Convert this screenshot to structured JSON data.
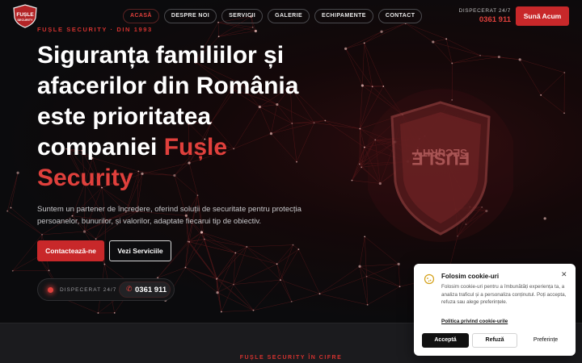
{
  "brand": {
    "logo_text_top": "FUȘLE",
    "logo_text_bottom": "SECURITY",
    "accent_color": "#c8282a",
    "accent_text_color": "#e0403c"
  },
  "nav": {
    "items": [
      {
        "label": "ACASĂ",
        "active": true
      },
      {
        "label": "DESPRE NOI",
        "active": false
      },
      {
        "label": "SERVICII",
        "active": false
      },
      {
        "label": "GALERIE",
        "active": false
      },
      {
        "label": "ECHIPAMENTE",
        "active": false
      },
      {
        "label": "CONTACT",
        "active": false
      }
    ]
  },
  "header": {
    "dispatch_label": "DISPECERAT 24/7",
    "dispatch_number": "0361 911",
    "call_button": "Sună Acum"
  },
  "hero": {
    "kicker": "FUȘLE SECURITY · DIN 1993",
    "headline_lines": [
      "Siguranța familiilor și",
      "afacerilor din România",
      "este prioritatea",
      "companiei "
    ],
    "headline_accent_inline": "Fușle",
    "headline_accent_line": "Security",
    "lead": "Suntem un partener de încredere, oferind soluții de securitate pentru protecția persoanelor, bunurilor, și valorilor, adaptate fiecarui tip de obiectiv.",
    "primary_button": "Contactează-ne",
    "secondary_button": "Vezi Serviciile",
    "dispatch_label": "DISPECERAT 24/7",
    "dispatch_number": "0361 911",
    "shield_text_top": "FUȘLE",
    "shield_text_bottom": "SECURITY"
  },
  "stats": {
    "kicker": "FUȘLE SECURITY ÎN CIFRE"
  },
  "cookie": {
    "title": "Folosim cookie-uri",
    "text": "Folosim cookie-uri pentru a îmbunătăți experiența ta, a analiza traficul și a personaliza conținutul. Poți accepta, refuza sau alege preferințele.",
    "link": "Politica privind cookie-urile",
    "accept": "Acceptă",
    "refuse": "Refuză",
    "preferences": "Preferințe",
    "close_icon": "close-icon"
  }
}
